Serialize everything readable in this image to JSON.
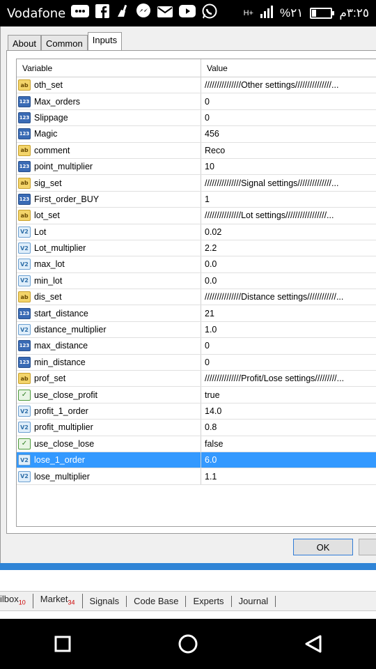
{
  "status_bar": {
    "carrier": "Vodafone",
    "network": "H+",
    "battery_percent": "%٢١",
    "time": "٣:٢٥م"
  },
  "tabs": [
    {
      "label": "About"
    },
    {
      "label": "Common"
    },
    {
      "label": "Inputs"
    }
  ],
  "grid": {
    "headers": {
      "variable": "Variable",
      "value": "Value"
    },
    "rows": [
      {
        "type": "ab",
        "name": "oth_set",
        "value": "///////////////Other settings///////////////..."
      },
      {
        "type": "123",
        "name": "Max_orders",
        "value": "0"
      },
      {
        "type": "123",
        "name": "Slippage",
        "value": "0"
      },
      {
        "type": "123",
        "name": "Magic",
        "value": "456"
      },
      {
        "type": "ab",
        "name": "comment",
        "value": "Reco"
      },
      {
        "type": "123",
        "name": "point_multiplier",
        "value": "10"
      },
      {
        "type": "ab",
        "name": "sig_set",
        "value": "///////////////Signal settings//////////////..."
      },
      {
        "type": "123",
        "name": "First_order_BUY",
        "value": "1"
      },
      {
        "type": "ab",
        "name": "lot_set",
        "value": "///////////////Lot settings/////////////////..."
      },
      {
        "type": "v2",
        "name": "Lot",
        "value": "0.02"
      },
      {
        "type": "v2",
        "name": "Lot_multiplier",
        "value": "2.2"
      },
      {
        "type": "v2",
        "name": "max_lot",
        "value": "0.0"
      },
      {
        "type": "v2",
        "name": "min_lot",
        "value": "0.0"
      },
      {
        "type": "ab",
        "name": "dis_set",
        "value": "///////////////Distance settings////////////..."
      },
      {
        "type": "123",
        "name": "start_distance",
        "value": "21"
      },
      {
        "type": "v2",
        "name": "distance_multiplier",
        "value": "1.0"
      },
      {
        "type": "123",
        "name": "max_distance",
        "value": "0"
      },
      {
        "type": "123",
        "name": "min_distance",
        "value": "0"
      },
      {
        "type": "ab",
        "name": "prof_set",
        "value": "///////////////Profit/Lose settings/////////..."
      },
      {
        "type": "bool",
        "name": "use_close_profit",
        "value": "true"
      },
      {
        "type": "v2",
        "name": "profit_1_order",
        "value": "14.0"
      },
      {
        "type": "v2",
        "name": "profit_multiplier",
        "value": "0.8"
      },
      {
        "type": "bool",
        "name": "use_close_lose",
        "value": "false"
      },
      {
        "type": "v2",
        "name": "lose_1_order",
        "value": "6.0",
        "selected": true
      },
      {
        "type": "v2",
        "name": "lose_multiplier",
        "value": "1.1"
      }
    ]
  },
  "buttons": {
    "ok": "OK"
  },
  "bottom_tabs": [
    {
      "label": "ilbox",
      "badge": "10"
    },
    {
      "label": "Market",
      "badge": "34"
    },
    {
      "label": "Signals",
      "badge": ""
    },
    {
      "label": "Code Base",
      "badge": ""
    },
    {
      "label": "Experts",
      "badge": ""
    },
    {
      "label": "Journal",
      "badge": ""
    }
  ],
  "icon_types": {
    "ab": {
      "glyph": "ab",
      "icon": "string-type-icon"
    },
    "123": {
      "glyph": "123",
      "icon": "integer-type-icon"
    },
    "v2": {
      "glyph": "V2",
      "icon": "double-type-icon"
    },
    "bool": {
      "glyph": "✓",
      "icon": "bool-type-icon"
    }
  },
  "colors": {
    "selection": "#3399ff",
    "accent": "#2f84d6"
  }
}
